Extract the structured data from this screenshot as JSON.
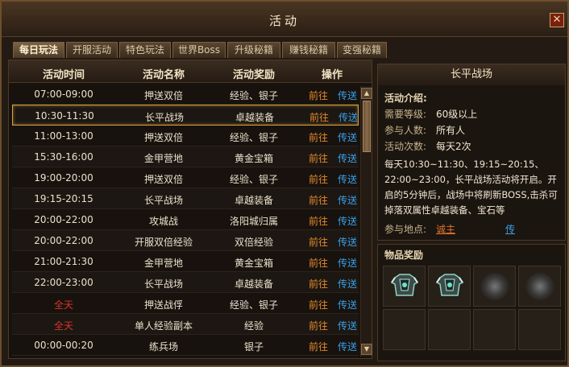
{
  "window": {
    "title": "活动",
    "close_label": "✕"
  },
  "tabs": [
    "每日玩法",
    "开服活动",
    "特色玩法",
    "世界Boss",
    "升级秘籍",
    "赚钱秘籍",
    "变强秘籍"
  ],
  "active_tab": 0,
  "table": {
    "headers": [
      "活动时间",
      "活动名称",
      "活动奖励",
      "操作"
    ],
    "go_label": "前往",
    "teleport_label": "传送",
    "rows": [
      {
        "time": "07:00-09:00",
        "name": "押送双倍",
        "reward": "经验、银子",
        "time_red": false
      },
      {
        "time": "10:30-11:30",
        "name": "长平战场",
        "reward": "卓越装备",
        "time_red": false,
        "selected": true
      },
      {
        "time": "11:00-13:00",
        "name": "押送双倍",
        "reward": "经验、银子",
        "time_red": false
      },
      {
        "time": "15:30-16:00",
        "name": "金甲营地",
        "reward": "黄金宝箱",
        "time_red": false
      },
      {
        "time": "19:00-20:00",
        "name": "押送双倍",
        "reward": "经验、银子",
        "time_red": false
      },
      {
        "time": "19:15-20:15",
        "name": "长平战场",
        "reward": "卓越装备",
        "time_red": false
      },
      {
        "time": "20:00-22:00",
        "name": "攻城战",
        "reward": "洛阳城归属",
        "time_red": false
      },
      {
        "time": "20:00-22:00",
        "name": "开服双倍经验",
        "reward": "双倍经验",
        "time_red": false
      },
      {
        "time": "21:00-21:30",
        "name": "金甲营地",
        "reward": "黄金宝箱",
        "time_red": false
      },
      {
        "time": "22:00-23:00",
        "name": "长平战场",
        "reward": "卓越装备",
        "time_red": false
      },
      {
        "time": "全天",
        "name": "押送战俘",
        "reward": "经验、银子",
        "time_red": true
      },
      {
        "time": "全天",
        "name": "单人经验副本",
        "reward": "经验",
        "time_red": true
      },
      {
        "time": "00:00-00:20",
        "name": "练兵场",
        "reward": "银子",
        "time_red": false
      }
    ]
  },
  "detail": {
    "title": "长平战场",
    "intro_label": "活动介绍:",
    "level_label": "需要等级:",
    "level_value": "60级以上",
    "people_label": "参与人数:",
    "people_value": "所有人",
    "times_label": "活动次数:",
    "times_value": "每天2次",
    "description": "每天10:30~11:30、19:15~20:15、22:00~23:00，长平战场活动将开启。开启的5分钟后，战场中将刷新BOSS,击杀可掉落双属性卓越装备、宝石等",
    "location_label": "参与地点:",
    "location_link": "诚主",
    "teleport_link": "传"
  },
  "rewards": {
    "label": "物品奖励",
    "slots": [
      "armor-item-icon",
      "armor-item-icon",
      "mystery-orb-icon",
      "mystery-orb-icon",
      "empty",
      "empty",
      "empty",
      "empty"
    ]
  },
  "colors": {
    "go": "#e48a2a",
    "teleport": "#3aa0e8",
    "highlight": "#d8a23c",
    "red_time": "#d8342a"
  }
}
